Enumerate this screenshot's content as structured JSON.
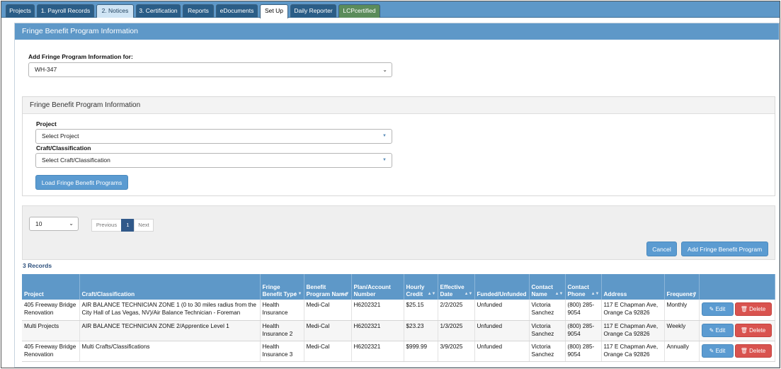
{
  "tabs": [
    {
      "label": "Projects"
    },
    {
      "label": "1. Payroll Records"
    },
    {
      "label": "2. Notices"
    },
    {
      "label": "3. Certification"
    },
    {
      "label": "Reports"
    },
    {
      "label": "eDocuments"
    },
    {
      "label": "Set Up"
    },
    {
      "label": "Daily Reporter"
    },
    {
      "label": "LCPcertified"
    }
  ],
  "page": {
    "header": "Fringe Benefit Program Information",
    "add_for_label": "Add Fringe Program Information for:",
    "add_for_value": "WH-347"
  },
  "filter_panel": {
    "title": "Fringe Benefit Program Information",
    "project_label": "Project",
    "project_value": "Select Project",
    "craft_label": "Craft/Classification",
    "craft_value": "Select Craft/Classification",
    "load_button": "Load Fringe Benefit Programs"
  },
  "list": {
    "page_size": "10",
    "prev": "Previous",
    "current_page": "1",
    "next": "Next",
    "cancel": "Cancel",
    "add_button": "Add Fringe Benefit Program",
    "records": "3 Records"
  },
  "table": {
    "headers": [
      "Project",
      "Craft/Classification",
      "Fringe Benefit Type",
      "Benefit Program Name",
      "Plan/Account Number",
      "Hourly Credit",
      "Effective Date",
      "Funded/Unfunded",
      "Contact Name",
      "Contact Phone",
      "Address",
      "Frequency",
      ""
    ],
    "rows": [
      {
        "project": "405 Freeway Bridge Renovation",
        "craft": "AIR BALANCE TECHNICIAN ZONE 1 (0 to 30 miles radius from the City Hall of Las Vegas, NV)/Air Balance Technician - Foreman",
        "type": "Health Insurance",
        "program": "Medi-Cal",
        "plan": "H6202321",
        "credit": "$25.15",
        "date": "2/2/2025",
        "funded": "Unfunded",
        "contact": "Victoria Sanchez",
        "phone": "(800) 285-9054",
        "address": "117 E Chapman Ave, Orange Ca 92826",
        "freq": "Monthly",
        "edit": "Edit",
        "delete": "Delete"
      },
      {
        "project": "Multi Projects",
        "craft": "AIR BALANCE TECHNICIAN ZONE 2/Apprentice Level 1",
        "type": "Health Insurance 2",
        "program": "Medi-Cal",
        "plan": "H6202321",
        "credit": "$23.23",
        "date": "1/3/2025",
        "funded": "Unfunded",
        "contact": "Victoria Sanchez",
        "phone": "(800) 285-9054",
        "address": "117 E Chapman Ave, Orange Ca 92826",
        "freq": "Weekly",
        "edit": "Edit",
        "delete": "Delete"
      },
      {
        "project": "405 Freeway Bridge Renovation",
        "craft": "Multi Crafts/Classifications",
        "type": "Health Insurance 3",
        "program": "Medi-Cal",
        "plan": "H6202321",
        "credit": "$999.99",
        "date": "3/9/2025",
        "funded": "Unfunded",
        "contact": "Victoria Sanchez",
        "phone": "(800) 285-9054",
        "address": "117 E Chapman Ave, Orange Ca 92826",
        "freq": "Annually",
        "edit": "Edit",
        "delete": "Delete"
      }
    ]
  }
}
